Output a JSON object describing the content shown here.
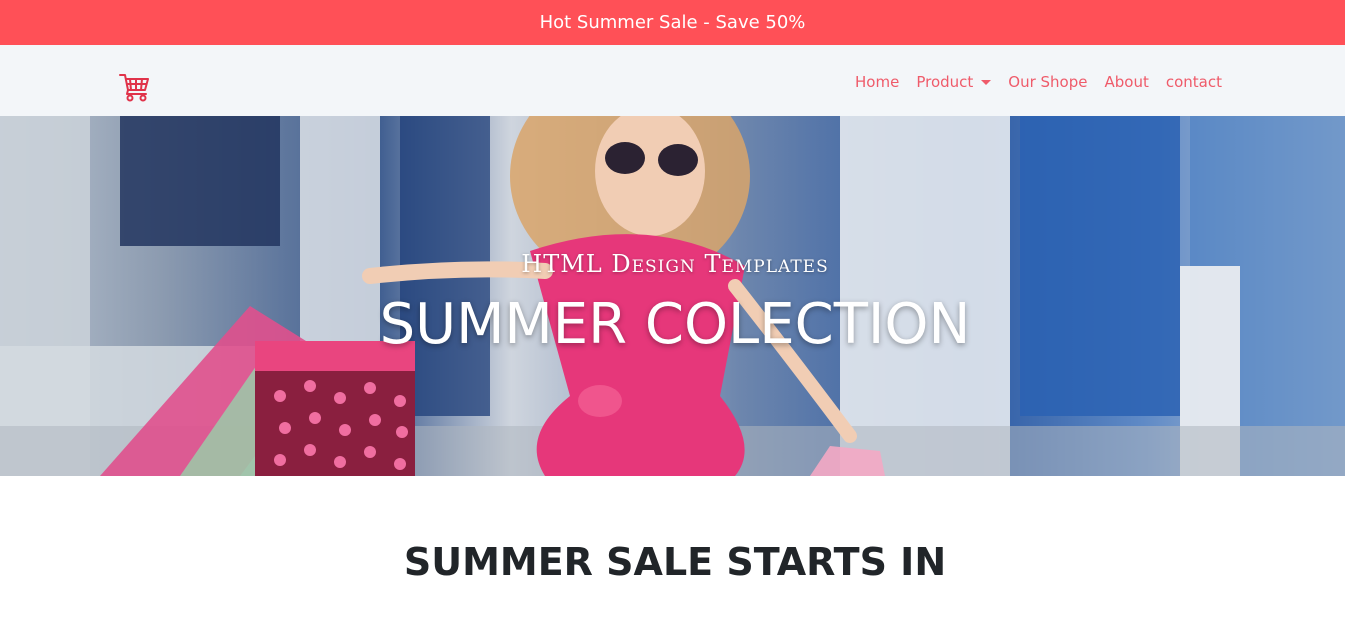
{
  "promo": {
    "text": "Hot Summer Sale - Save 50%"
  },
  "navbar": {
    "logo_icon": "shopping-cart-icon",
    "items": [
      {
        "label": "Home",
        "dropdown": false
      },
      {
        "label": "Product",
        "dropdown": true
      },
      {
        "label": "Our Shope",
        "dropdown": false
      },
      {
        "label": "About",
        "dropdown": false
      },
      {
        "label": "contact",
        "dropdown": false
      }
    ]
  },
  "hero": {
    "subtitle": "HTML Design Templates",
    "title": "SUMMER COLECTION"
  },
  "section": {
    "title": "SUMMER SALE STARTS IN"
  },
  "colors": {
    "promo_bg": "#ff5057",
    "nav_link": "#ef5b6a",
    "logo": "#e0334a"
  }
}
